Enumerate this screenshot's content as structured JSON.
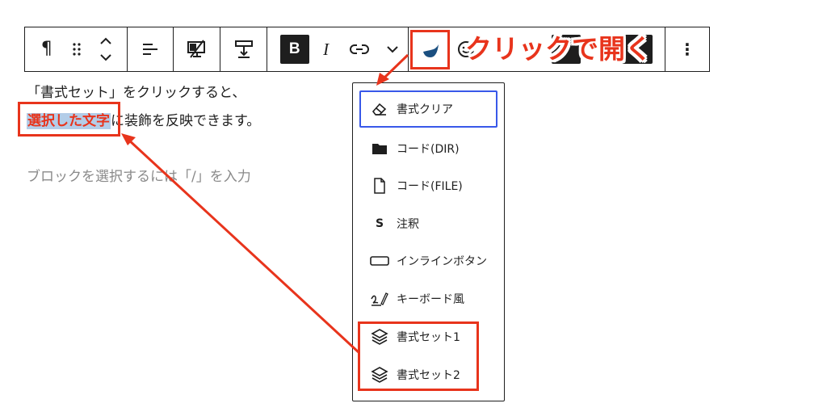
{
  "toolbar": {
    "paragraph_icon": "¶",
    "more_icon": "⋮",
    "bold_label": "B",
    "italic_label": "I",
    "groups": [
      "block-type",
      "align",
      "text-transform",
      "format",
      "more"
    ]
  },
  "annotation": {
    "label": "クリックで開く",
    "accent_color": "#e8341c"
  },
  "editor": {
    "line1": "「書式セット」をクリックすると、",
    "line2_selected": "選択した文字",
    "line2_rest": "に装飾を反映できます。",
    "placeholder": "ブロックを選択するには「/」を入力"
  },
  "dropdown": {
    "items": [
      {
        "label": "書式クリア",
        "icon": "eraser-icon",
        "focused": true
      },
      {
        "label": "コード(DIR)",
        "icon": "folder-icon"
      },
      {
        "label": "コード(FILE)",
        "icon": "file-icon"
      },
      {
        "label": "注釈",
        "icon": "s-letter-icon",
        "glyph": "S"
      },
      {
        "label": "インラインボタン",
        "icon": "button-outline-icon"
      },
      {
        "label": "キーボード風",
        "icon": "pen-signature-icon"
      },
      {
        "label": "書式セット1",
        "icon": "stack-layers-icon"
      },
      {
        "label": "書式セット2",
        "icon": "stack-layers-icon"
      }
    ],
    "focus_color": "#3858e9"
  }
}
